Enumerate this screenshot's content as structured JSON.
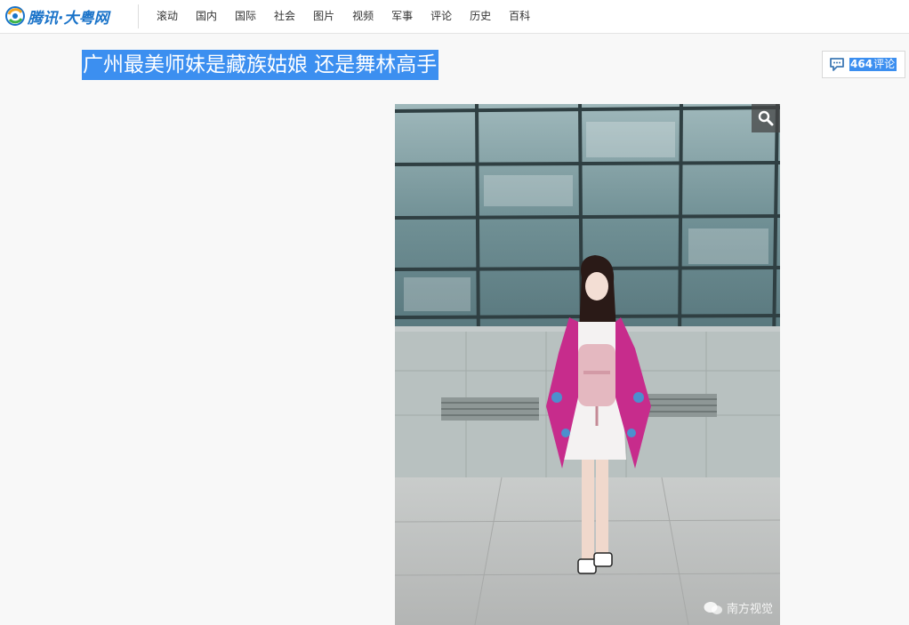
{
  "header": {
    "logo_text": "腾讯·大粤网",
    "nav": [
      "滚动",
      "国内",
      "国际",
      "社会",
      "图片",
      "视频",
      "军事",
      "评论",
      "历史",
      "百科"
    ]
  },
  "article": {
    "title": "广州最美师妹是藏族姑娘 还是舞林高手",
    "comments": {
      "count": "464",
      "label": "评论"
    }
  },
  "photo": {
    "watermark": "南方视觉",
    "zoom_icon": "magnifier-icon"
  },
  "colors": {
    "selection_highlight": "#3c8ff0",
    "logo_blue": "#1a73c9"
  }
}
